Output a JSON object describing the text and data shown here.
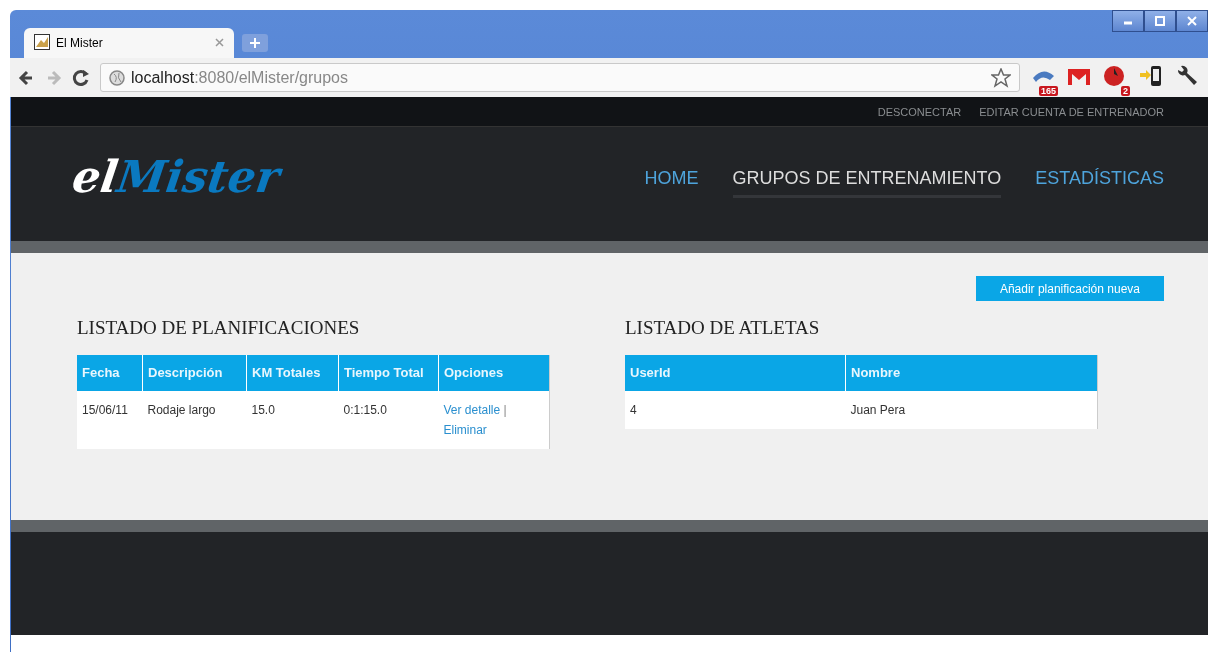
{
  "browser": {
    "tabs": [
      {
        "title": "El Mister",
        "selected": true
      }
    ],
    "address": {
      "host": "localhost",
      "path": ":8080/elMister/grupos"
    },
    "extension_badges": [
      "165",
      "2"
    ]
  },
  "top_links": [
    "DESCONECTAR",
    "EDITAR CUENTA DE ENTRENADOR"
  ],
  "logo": {
    "prefix": "el",
    "name": "Mister"
  },
  "nav": [
    {
      "label": "HOME",
      "selected": false
    },
    {
      "label": "GRUPOS DE ENTRENAMIENTO",
      "selected": true
    },
    {
      "label": "ESTADÍSTICAS",
      "selected": false
    }
  ],
  "add_button": "Añadir planificación nueva",
  "plans": {
    "title": "LISTADO DE PLANIFICACIONES",
    "columns": [
      "Fecha",
      "Descripción",
      "KM Totales",
      "Tiempo Total",
      "Opciones"
    ],
    "rows": [
      {
        "cells": [
          "15/06/11",
          "Rodaje largo",
          "15.0",
          "0:1:15.0"
        ],
        "actions": [
          "Ver detalle",
          "Eliminar"
        ],
        "separator": "|"
      }
    ]
  },
  "athletes": {
    "title": "LISTADO DE ATLETAS",
    "columns": [
      "UserId",
      "Nombre"
    ],
    "rows": [
      {
        "cells": [
          "4",
          "Juan Pera"
        ]
      }
    ]
  }
}
